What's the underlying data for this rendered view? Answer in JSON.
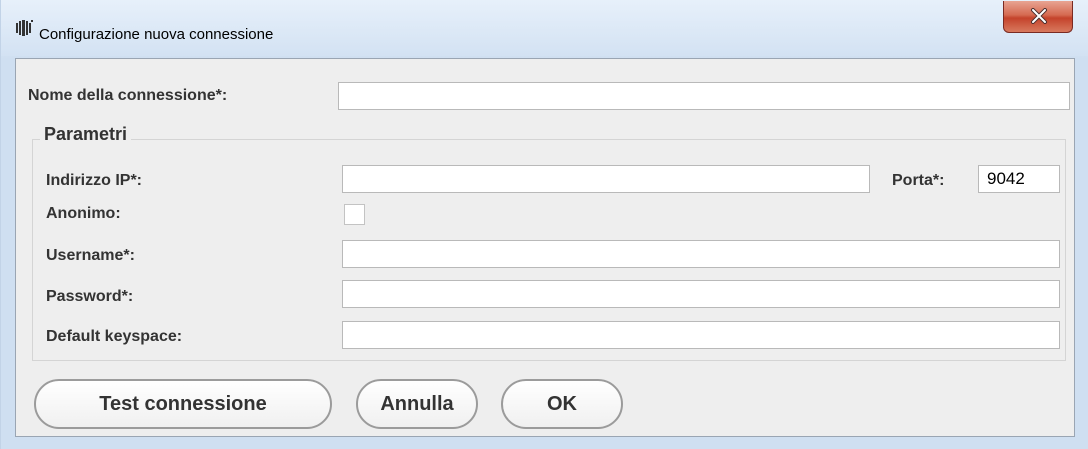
{
  "window": {
    "title": "Configurazione nuova connessione",
    "close_label": "X"
  },
  "form": {
    "connection_name_label": "Nome della connessione*:",
    "connection_name_value": "",
    "group_title": "Parametri",
    "ip_label": "Indirizzo IP*:",
    "ip_value": "",
    "port_label": "Porta*:",
    "port_value": "9042",
    "anonymous_label": "Anonimo:",
    "anonymous_checked": false,
    "username_label": "Username*:",
    "username_value": "",
    "password_label": "Password*:",
    "password_value": "",
    "keyspace_label": "Default keyspace:",
    "keyspace_value": ""
  },
  "buttons": {
    "test": "Test connessione",
    "cancel": "Annulla",
    "ok": "OK"
  },
  "icons": {
    "app": "barcode-app-icon",
    "close": "close-icon"
  }
}
